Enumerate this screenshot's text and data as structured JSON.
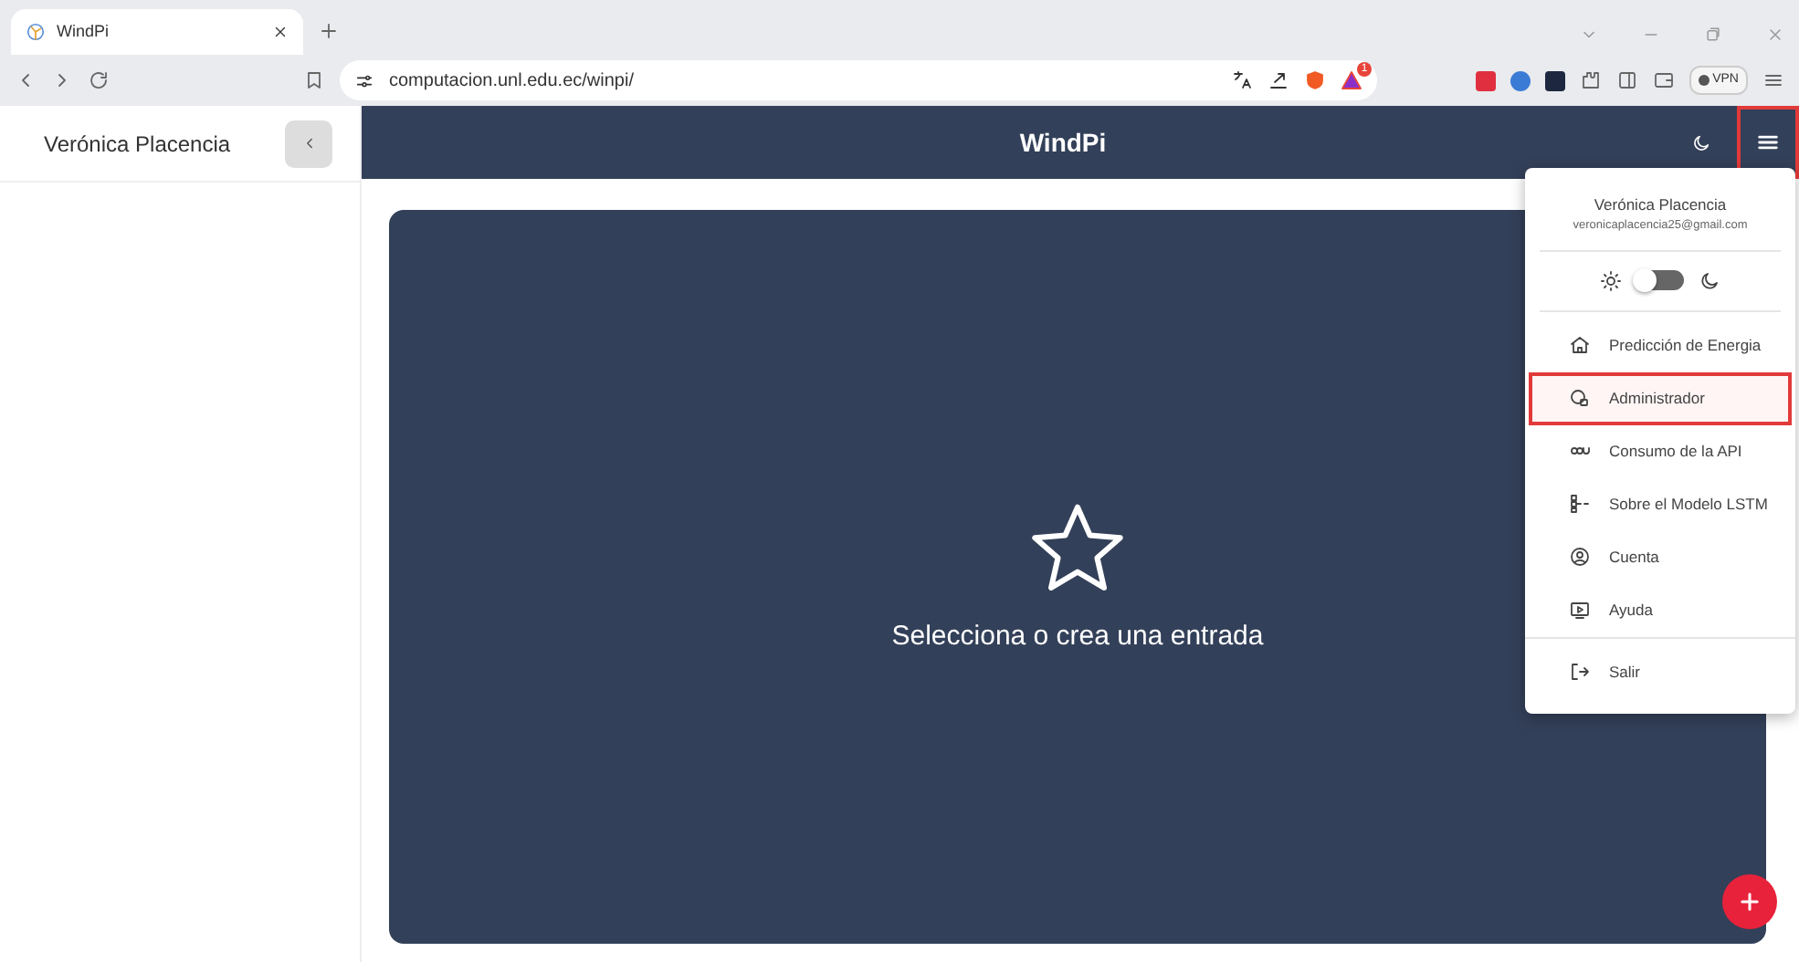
{
  "browser": {
    "tabs": [
      {
        "title": "WindPi",
        "selected": true
      }
    ],
    "address": "computacion.unl.edu.ec/winpi/",
    "vpn_label": "VPN",
    "alert_badge": "1"
  },
  "sidebar": {
    "user_name": "Verónica Placencia"
  },
  "header": {
    "title": "WindPi",
    "menu_highlighted": true
  },
  "main": {
    "empty_message": "Selecciona o crea una entrada"
  },
  "user_menu": {
    "name": "Verónica Placencia",
    "email": "veronicaplacencia25@gmail.com",
    "dark_mode": false,
    "items": [
      {
        "label": "Predicción de Energia",
        "highlighted": false
      },
      {
        "label": "Administrador",
        "highlighted": true
      },
      {
        "label": "Consumo de la API",
        "highlighted": false
      },
      {
        "label": "Sobre el Modelo LSTM",
        "highlighted": false
      },
      {
        "label": "Cuenta",
        "highlighted": false
      },
      {
        "label": "Ayuda",
        "highlighted": false
      }
    ],
    "logout": "Salir"
  }
}
